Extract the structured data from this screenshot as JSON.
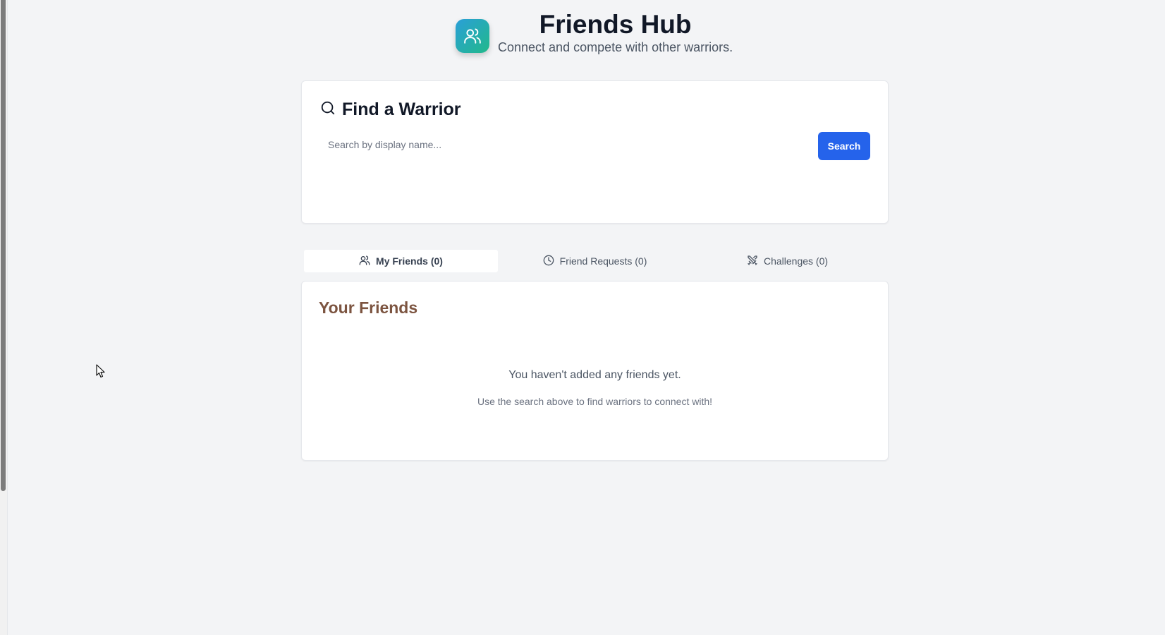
{
  "header": {
    "title": "Friends Hub",
    "subtitle": "Connect and compete with other warriors.",
    "logo_icon": "users-icon"
  },
  "search": {
    "heading": "Find a Warrior",
    "placeholder": "Search by display name...",
    "value": "",
    "button_label": "Search"
  },
  "tabs": [
    {
      "label": "My Friends (0)",
      "icon": "users-icon",
      "active": true
    },
    {
      "label": "Friend Requests (0)",
      "icon": "clock-icon",
      "active": false
    },
    {
      "label": "Challenges (0)",
      "icon": "swords-icon",
      "active": false
    }
  ],
  "friends": {
    "title": "Your Friends",
    "empty_message": "You haven't added any friends yet.",
    "empty_hint": "Use the search above to find warriors to connect with!"
  },
  "colors": {
    "accent": "#2563eb",
    "background": "#f3f4f6",
    "section_title": "#7c5440"
  }
}
